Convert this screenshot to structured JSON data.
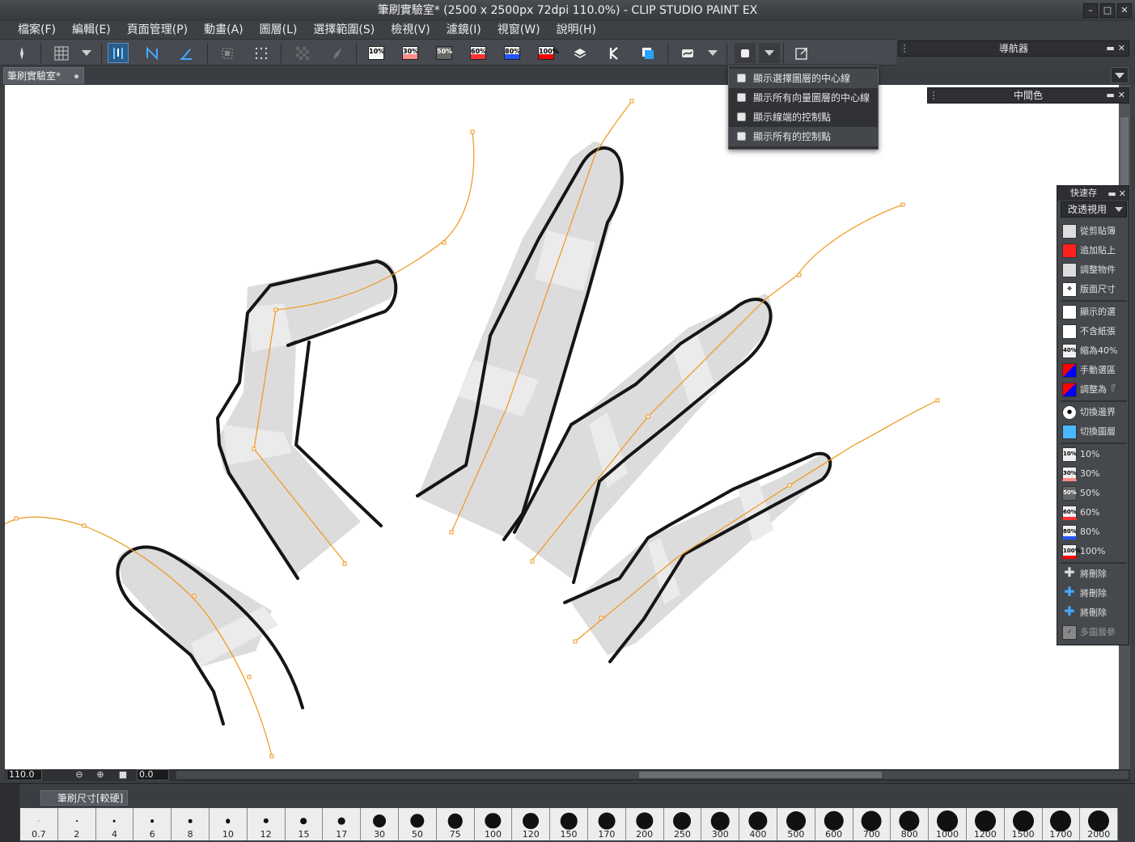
{
  "window": {
    "title": "筆刷實驗室* (2500 x 2500px 72dpi 110.0%)  - CLIP STUDIO PAINT EX",
    "btn_minimize": "–",
    "btn_restore": "□",
    "btn_close": "✕"
  },
  "menu": [
    "檔案(F)",
    "編輯(E)",
    "頁面管理(P)",
    "動畫(A)",
    "圖層(L)",
    "選擇範圍(S)",
    "檢視(V)",
    "濾鏡(I)",
    "視窗(W)",
    "說明(H)"
  ],
  "toolbar": {
    "percent_buttons": [
      {
        "label": "10%",
        "color": "#ffffff"
      },
      {
        "label": "30%",
        "color": "#ff8a8a"
      },
      {
        "label": "50%",
        "color": "#666666"
      },
      {
        "label": "60%",
        "color": "#ff3333"
      },
      {
        "label": "80%",
        "color": "#2255ff"
      },
      {
        "label": "100%",
        "color": "#ff0000"
      }
    ]
  },
  "panels": {
    "navigator": "導航器",
    "mid_color": "中間色",
    "quick_access": "快速存"
  },
  "document_tab": "筆刷實驗室*",
  "context_menu": {
    "items": [
      "顯示選擇圖層的中心線",
      "顯示所有向量圖層的中心線",
      "顯示線端的控制點",
      "顯示所有的控制點"
    ]
  },
  "quick_access": {
    "selected": "改透視用",
    "items": [
      {
        "label": "從剪貼簿",
        "icon": ""
      },
      {
        "label": "追加貼上",
        "icon": ""
      },
      {
        "label": "調整物件",
        "icon": ""
      },
      {
        "label": "版面尺寸",
        "icon": ""
      },
      {
        "label": "顯示的選",
        "icon": ""
      },
      {
        "label": "不含紙張",
        "icon": ""
      },
      {
        "label": "縮為40%",
        "icon": "40%"
      },
      {
        "label": "手動選區",
        "icon": ""
      },
      {
        "label": "調整為『",
        "icon": ""
      },
      {
        "label": "切換邊界",
        "icon": ""
      },
      {
        "label": "切換圖層",
        "icon": ""
      },
      {
        "label": "10%",
        "icon": "10%"
      },
      {
        "label": "30%",
        "icon": "30%"
      },
      {
        "label": "50%",
        "icon": "50%"
      },
      {
        "label": "60%",
        "icon": "60%"
      },
      {
        "label": "80%",
        "icon": "80%"
      },
      {
        "label": "100%",
        "icon": "100%"
      },
      {
        "label": "將刪除",
        "icon": ""
      },
      {
        "label": "將刪除",
        "icon": ""
      },
      {
        "label": "將刪除",
        "icon": ""
      },
      {
        "label": "多圖層參",
        "icon": ""
      }
    ]
  },
  "status": {
    "zoom": "110.0",
    "angle": "0.0"
  },
  "brush_size": {
    "tab_label": "筆刷尺寸[較硬]",
    "sizes": [
      "0.7",
      "2",
      "4",
      "6",
      "8",
      "10",
      "12",
      "15",
      "17",
      "30",
      "50",
      "75",
      "100",
      "120",
      "150",
      "170",
      "200",
      "250",
      "300",
      "400",
      "500",
      "600",
      "700",
      "800",
      "1000",
      "1200",
      "1500",
      "1700",
      "2000"
    ]
  }
}
